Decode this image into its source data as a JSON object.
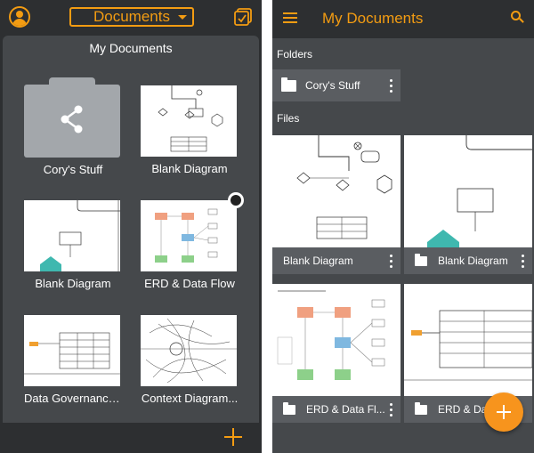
{
  "left_app": {
    "dropdown_label": "Documents",
    "panel_title": "My Documents",
    "items": [
      {
        "label": "Cory's Stuff",
        "kind": "folder"
      },
      {
        "label": "Blank Diagram",
        "kind": "diagram"
      },
      {
        "label": "Blank Diagram",
        "kind": "diagram"
      },
      {
        "label": "ERD & Data Flow",
        "kind": "diagram"
      },
      {
        "label": "Data Governance...",
        "kind": "diagram"
      },
      {
        "label": "Context Diagram...",
        "kind": "diagram"
      }
    ],
    "accent_color": "#f39c12"
  },
  "right_app": {
    "title": "My Documents",
    "folders_heading": "Folders",
    "files_heading": "Files",
    "folder_label": "Cory's Stuff",
    "files": [
      {
        "label": "Blank Diagram"
      },
      {
        "label": "Blank Diagram"
      },
      {
        "label": "ERD & Data Fl..."
      },
      {
        "label": "ERD & Da"
      }
    ],
    "accent_color": "#f7941d"
  }
}
